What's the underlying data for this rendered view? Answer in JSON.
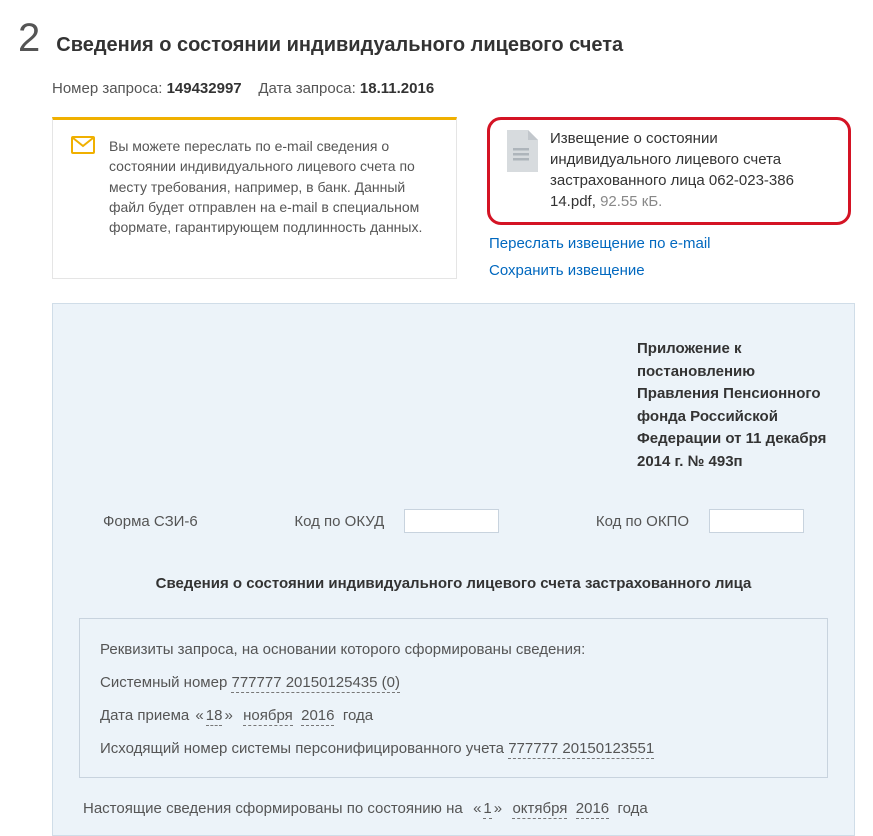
{
  "step": "2",
  "title": "Сведения о состоянии индивидуального лицевого счета",
  "meta": {
    "request_num_label": "Номер запроса:",
    "request_num": "149432997",
    "request_date_label": "Дата запроса:",
    "request_date": "18.11.2016"
  },
  "notice": "Вы можете переслать по e-mail сведения о состоянии индивидуального лицевого счета по месту требования, например, в банк. Данный файл будет отправлен на e-mail в специальном формате, гарантирующем подлинность данных.",
  "file": {
    "name": "Извещение о состоянии индивидуального лицевого счета застрахованного лица 062-023-386 14.pdf",
    "size": "92.55 кБ."
  },
  "links": {
    "forward": "Переслать извещение по e-mail",
    "save": "Сохранить извещение"
  },
  "decree": "Приложение к постановлению Правления Пенсионного фонда Российской Федерации от 11 декабря 2014 г. № 493п",
  "codes": {
    "form": "Форма СЗИ-6",
    "okud": "Код по ОКУД",
    "okpo": "Код по ОКПО"
  },
  "form_title": "Сведения о состоянии индивидуального лицевого счета застрахованного лица",
  "req": {
    "heading": "Реквизиты запроса, на основании которого сформированы сведения:",
    "sys_label": "Системный номер",
    "sys_num": "777777 20150125435 (0)",
    "date_label": "Дата приема",
    "date_day": "18",
    "date_month": "ноября",
    "date_year": "2016",
    "year_word": "года",
    "out_label": "Исходящий номер системы персонифицированного учета",
    "out_num": "777777 20150123551"
  },
  "final": {
    "prefix": "Настоящие сведения сформированы по состоянию на",
    "day": "1",
    "month": "октября",
    "year": "2016",
    "year_word": "года"
  }
}
